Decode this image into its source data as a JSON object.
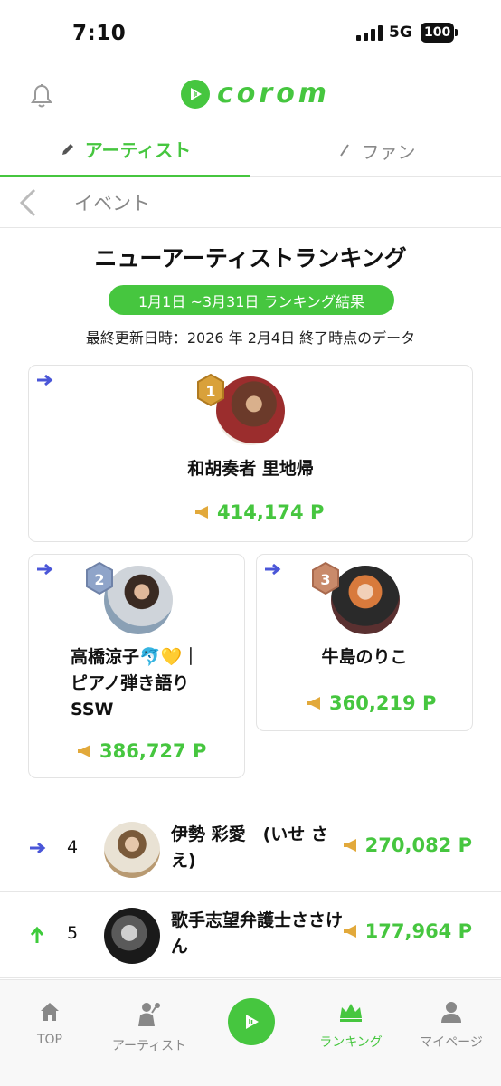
{
  "status_bar": {
    "time": "7:10",
    "network": "5G",
    "battery": "100"
  },
  "header": {
    "logo_text": "corom",
    "icons": [
      "bell-icon",
      "corom-logo-icon"
    ]
  },
  "tabs": [
    {
      "label": "アーティスト",
      "icon": "pen-icon",
      "active": true
    },
    {
      "label": "ファン",
      "icon": "slash-icon",
      "active": false
    }
  ],
  "subheader": {
    "title": "イベント"
  },
  "ranking": {
    "title": "ニューアーティストランキング",
    "period": "1月1日 ~3月31日 ランキング結果",
    "updated": "最終更新日時：2026 年 2月4日 終了時点のデータ"
  },
  "top3": [
    {
      "rank": "1",
      "name": "和胡奏者 里地帰",
      "points": "414,174 P",
      "trend": "flat"
    },
    {
      "rank": "2",
      "name": "高橋涼子🐬💛｜ピアノ弾き語りSSW",
      "points": "386,727 P",
      "trend": "flat"
    },
    {
      "rank": "3",
      "name": "牛島のりこ",
      "points": "360,219 P",
      "trend": "flat"
    }
  ],
  "list": [
    {
      "rank": "4",
      "name": "伊勢 彩愛　(いせ さえ)",
      "points": "270,082 P",
      "trend": "flat"
    },
    {
      "rank": "5",
      "name": "歌手志望弁護士ささけん",
      "points": "177,964 P",
      "trend": "up"
    }
  ],
  "bottom_nav": [
    {
      "label": "TOP",
      "icon": "home-icon"
    },
    {
      "label": "アーティスト",
      "icon": "singer-icon"
    },
    {
      "label": "",
      "icon": "corom-center-icon"
    },
    {
      "label": "ランキング",
      "icon": "crown-icon",
      "active": true
    },
    {
      "label": "マイページ",
      "icon": "person-icon"
    }
  ],
  "colors": {
    "accent": "#46c63f",
    "trend_flat": "#4a56d8",
    "trend_up": "#3ecb3b",
    "gold": "#d9a13a",
    "silver": "#8fa4c9",
    "bronze": "#c98a6a"
  }
}
